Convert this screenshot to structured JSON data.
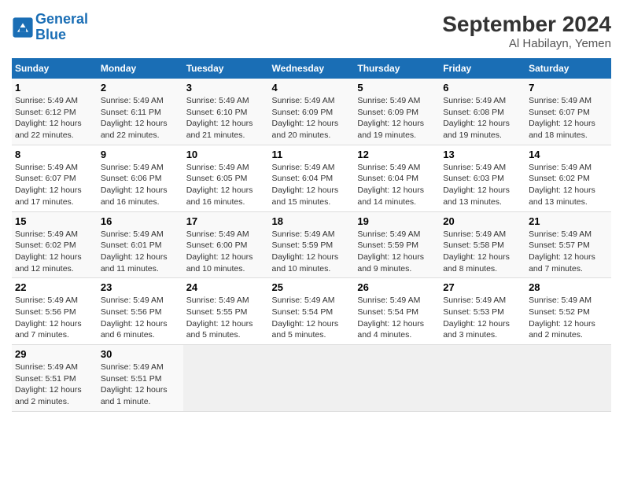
{
  "header": {
    "logo_line1": "General",
    "logo_line2": "Blue",
    "month": "September 2024",
    "location": "Al Habilayn, Yemen"
  },
  "columns": [
    "Sunday",
    "Monday",
    "Tuesday",
    "Wednesday",
    "Thursday",
    "Friday",
    "Saturday"
  ],
  "weeks": [
    [
      {
        "day": "1",
        "sunrise": "5:49 AM",
        "sunset": "6:12 PM",
        "daylight": "12 hours and 22 minutes."
      },
      {
        "day": "2",
        "sunrise": "5:49 AM",
        "sunset": "6:11 PM",
        "daylight": "12 hours and 22 minutes."
      },
      {
        "day": "3",
        "sunrise": "5:49 AM",
        "sunset": "6:10 PM",
        "daylight": "12 hours and 21 minutes."
      },
      {
        "day": "4",
        "sunrise": "5:49 AM",
        "sunset": "6:09 PM",
        "daylight": "12 hours and 20 minutes."
      },
      {
        "day": "5",
        "sunrise": "5:49 AM",
        "sunset": "6:09 PM",
        "daylight": "12 hours and 19 minutes."
      },
      {
        "day": "6",
        "sunrise": "5:49 AM",
        "sunset": "6:08 PM",
        "daylight": "12 hours and 19 minutes."
      },
      {
        "day": "7",
        "sunrise": "5:49 AM",
        "sunset": "6:07 PM",
        "daylight": "12 hours and 18 minutes."
      }
    ],
    [
      {
        "day": "8",
        "sunrise": "5:49 AM",
        "sunset": "6:07 PM",
        "daylight": "12 hours and 17 minutes."
      },
      {
        "day": "9",
        "sunrise": "5:49 AM",
        "sunset": "6:06 PM",
        "daylight": "12 hours and 16 minutes."
      },
      {
        "day": "10",
        "sunrise": "5:49 AM",
        "sunset": "6:05 PM",
        "daylight": "12 hours and 16 minutes."
      },
      {
        "day": "11",
        "sunrise": "5:49 AM",
        "sunset": "6:04 PM",
        "daylight": "12 hours and 15 minutes."
      },
      {
        "day": "12",
        "sunrise": "5:49 AM",
        "sunset": "6:04 PM",
        "daylight": "12 hours and 14 minutes."
      },
      {
        "day": "13",
        "sunrise": "5:49 AM",
        "sunset": "6:03 PM",
        "daylight": "12 hours and 13 minutes."
      },
      {
        "day": "14",
        "sunrise": "5:49 AM",
        "sunset": "6:02 PM",
        "daylight": "12 hours and 13 minutes."
      }
    ],
    [
      {
        "day": "15",
        "sunrise": "5:49 AM",
        "sunset": "6:02 PM",
        "daylight": "12 hours and 12 minutes."
      },
      {
        "day": "16",
        "sunrise": "5:49 AM",
        "sunset": "6:01 PM",
        "daylight": "12 hours and 11 minutes."
      },
      {
        "day": "17",
        "sunrise": "5:49 AM",
        "sunset": "6:00 PM",
        "daylight": "12 hours and 10 minutes."
      },
      {
        "day": "18",
        "sunrise": "5:49 AM",
        "sunset": "5:59 PM",
        "daylight": "12 hours and 10 minutes."
      },
      {
        "day": "19",
        "sunrise": "5:49 AM",
        "sunset": "5:59 PM",
        "daylight": "12 hours and 9 minutes."
      },
      {
        "day": "20",
        "sunrise": "5:49 AM",
        "sunset": "5:58 PM",
        "daylight": "12 hours and 8 minutes."
      },
      {
        "day": "21",
        "sunrise": "5:49 AM",
        "sunset": "5:57 PM",
        "daylight": "12 hours and 7 minutes."
      }
    ],
    [
      {
        "day": "22",
        "sunrise": "5:49 AM",
        "sunset": "5:56 PM",
        "daylight": "12 hours and 7 minutes."
      },
      {
        "day": "23",
        "sunrise": "5:49 AM",
        "sunset": "5:56 PM",
        "daylight": "12 hours and 6 minutes."
      },
      {
        "day": "24",
        "sunrise": "5:49 AM",
        "sunset": "5:55 PM",
        "daylight": "12 hours and 5 minutes."
      },
      {
        "day": "25",
        "sunrise": "5:49 AM",
        "sunset": "5:54 PM",
        "daylight": "12 hours and 5 minutes."
      },
      {
        "day": "26",
        "sunrise": "5:49 AM",
        "sunset": "5:54 PM",
        "daylight": "12 hours and 4 minutes."
      },
      {
        "day": "27",
        "sunrise": "5:49 AM",
        "sunset": "5:53 PM",
        "daylight": "12 hours and 3 minutes."
      },
      {
        "day": "28",
        "sunrise": "5:49 AM",
        "sunset": "5:52 PM",
        "daylight": "12 hours and 2 minutes."
      }
    ],
    [
      {
        "day": "29",
        "sunrise": "5:49 AM",
        "sunset": "5:51 PM",
        "daylight": "12 hours and 2 minutes."
      },
      {
        "day": "30",
        "sunrise": "5:49 AM",
        "sunset": "5:51 PM",
        "daylight": "12 hours and 1 minute."
      },
      null,
      null,
      null,
      null,
      null
    ]
  ]
}
